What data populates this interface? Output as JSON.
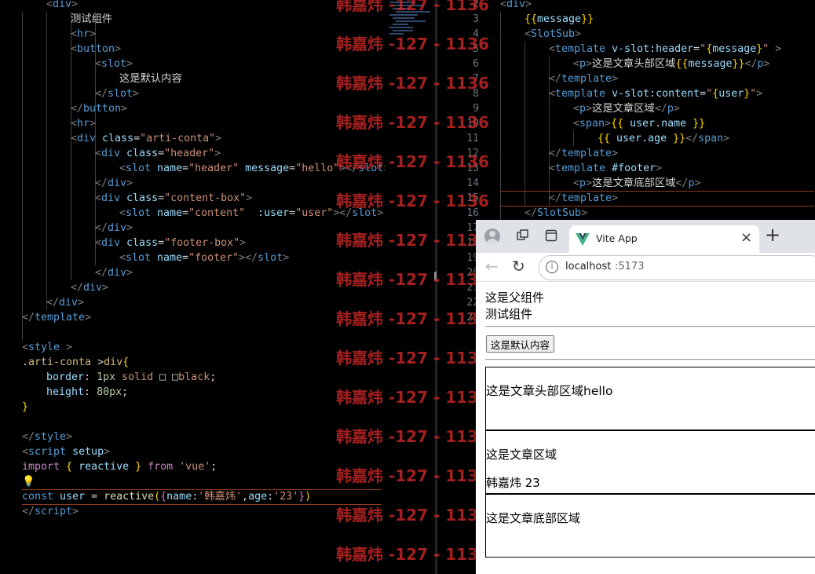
{
  "editor_left": {
    "lines": [
      {
        "indent": 2,
        "parts": [
          [
            "brk",
            "<"
          ],
          [
            "tag",
            "div"
          ],
          [
            "brk",
            ">"
          ]
        ]
      },
      {
        "indent": 3,
        "parts": [
          [
            "txt",
            "测试组件"
          ]
        ]
      },
      {
        "indent": 3,
        "parts": [
          [
            "brk",
            "<"
          ],
          [
            "tag",
            "hr"
          ],
          [
            "brk",
            ">"
          ]
        ]
      },
      {
        "indent": 3,
        "parts": [
          [
            "brk",
            "<"
          ],
          [
            "tag",
            "button"
          ],
          [
            "brk",
            ">"
          ]
        ]
      },
      {
        "indent": 4,
        "parts": [
          [
            "brk",
            "<"
          ],
          [
            "tag",
            "slot"
          ],
          [
            "brk",
            ">"
          ]
        ]
      },
      {
        "indent": 5,
        "parts": [
          [
            "txt",
            "这是默认内容"
          ]
        ]
      },
      {
        "indent": 4,
        "parts": [
          [
            "brk",
            "</"
          ],
          [
            "tag",
            "slot"
          ],
          [
            "brk",
            ">"
          ]
        ]
      },
      {
        "indent": 3,
        "parts": [
          [
            "brk",
            "</"
          ],
          [
            "tag",
            "button"
          ],
          [
            "brk",
            ">"
          ]
        ]
      },
      {
        "indent": 3,
        "parts": [
          [
            "brk",
            "<"
          ],
          [
            "tag",
            "hr"
          ],
          [
            "brk",
            ">"
          ]
        ]
      },
      {
        "indent": 3,
        "parts": [
          [
            "brk",
            "<"
          ],
          [
            "tag",
            "div "
          ],
          [
            "attr",
            "class"
          ],
          [
            "txt",
            "="
          ],
          [
            "str",
            "\"arti-conta\""
          ],
          [
            "brk",
            ">"
          ]
        ]
      },
      {
        "indent": 4,
        "parts": [
          [
            "brk",
            "<"
          ],
          [
            "tag",
            "div "
          ],
          [
            "attr",
            "class"
          ],
          [
            "txt",
            "="
          ],
          [
            "str",
            "\"header\""
          ],
          [
            "brk",
            ">"
          ]
        ]
      },
      {
        "indent": 5,
        "parts": [
          [
            "brk",
            "<"
          ],
          [
            "tag",
            "slot "
          ],
          [
            "attr",
            "name"
          ],
          [
            "txt",
            "="
          ],
          [
            "str",
            "\"header\" "
          ],
          [
            "attr",
            "message"
          ],
          [
            "txt",
            "="
          ],
          [
            "str",
            "\"hello\""
          ],
          [
            "brk",
            "></"
          ],
          [
            "tag",
            "slot"
          ],
          [
            "brk",
            ">"
          ]
        ]
      },
      {
        "indent": 4,
        "parts": [
          [
            "brk",
            "</"
          ],
          [
            "tag",
            "div"
          ],
          [
            "brk",
            ">"
          ]
        ]
      },
      {
        "indent": 4,
        "parts": [
          [
            "brk",
            "<"
          ],
          [
            "tag",
            "div "
          ],
          [
            "attr",
            "class"
          ],
          [
            "txt",
            "="
          ],
          [
            "str",
            "\"content-box\""
          ],
          [
            "brk",
            ">"
          ]
        ]
      },
      {
        "indent": 5,
        "parts": [
          [
            "brk",
            "<"
          ],
          [
            "tag",
            "slot "
          ],
          [
            "attr",
            "name"
          ],
          [
            "txt",
            "="
          ],
          [
            "str",
            "\"content\"  "
          ],
          [
            "attr",
            ":user"
          ],
          [
            "txt",
            "="
          ],
          [
            "str",
            "\"user\""
          ],
          [
            "brk",
            "></"
          ],
          [
            "tag",
            "slot"
          ],
          [
            "brk",
            ">"
          ]
        ]
      },
      {
        "indent": 4,
        "parts": [
          [
            "brk",
            "</"
          ],
          [
            "tag",
            "div"
          ],
          [
            "brk",
            ">"
          ]
        ]
      },
      {
        "indent": 4,
        "parts": [
          [
            "brk",
            "<"
          ],
          [
            "tag",
            "div "
          ],
          [
            "attr",
            "class"
          ],
          [
            "txt",
            "="
          ],
          [
            "str",
            "\"footer-box\""
          ],
          [
            "brk",
            ">"
          ]
        ]
      },
      {
        "indent": 5,
        "parts": [
          [
            "brk",
            "<"
          ],
          [
            "tag",
            "slot "
          ],
          [
            "attr",
            "name"
          ],
          [
            "txt",
            "="
          ],
          [
            "str",
            "\"footer\""
          ],
          [
            "brk",
            "></"
          ],
          [
            "tag",
            "slot"
          ],
          [
            "brk",
            ">"
          ]
        ]
      },
      {
        "indent": 4,
        "parts": [
          [
            "brk",
            "</"
          ],
          [
            "tag",
            "div"
          ],
          [
            "brk",
            ">"
          ]
        ]
      },
      {
        "indent": 3,
        "parts": [
          [
            "brk",
            "</"
          ],
          [
            "tag",
            "div"
          ],
          [
            "brk",
            ">"
          ]
        ]
      },
      {
        "indent": 2,
        "parts": [
          [
            "brk",
            "</"
          ],
          [
            "tag",
            "div"
          ],
          [
            "brk",
            ">"
          ]
        ]
      },
      {
        "indent": 1,
        "parts": [
          [
            "brk",
            "</"
          ],
          [
            "tag",
            "template"
          ],
          [
            "brk",
            ">"
          ]
        ]
      },
      {
        "indent": 1,
        "parts": []
      },
      {
        "indent": 1,
        "parts": [
          [
            "brk",
            "<"
          ],
          [
            "tag",
            "style "
          ],
          [
            "brk",
            ">"
          ]
        ]
      },
      {
        "indent": 1,
        "parts": [
          [
            "sel",
            ".arti-conta "
          ],
          [
            "txt",
            ">"
          ],
          [
            "sel",
            "div"
          ],
          [
            "brace",
            "{"
          ]
        ]
      },
      {
        "indent": 2,
        "parts": [
          [
            "attr",
            "border"
          ],
          [
            "txt",
            ": "
          ],
          [
            "num",
            "1px"
          ],
          [
            "str",
            " solid "
          ],
          [
            "txt",
            "□ □"
          ],
          [
            "str",
            "black"
          ],
          [
            "txt",
            ";"
          ]
        ]
      },
      {
        "indent": 2,
        "parts": [
          [
            "attr",
            "height"
          ],
          [
            "txt",
            ": "
          ],
          [
            "num",
            "80px"
          ],
          [
            "txt",
            ";"
          ]
        ]
      },
      {
        "indent": 1,
        "parts": [
          [
            "brace",
            "}"
          ]
        ]
      },
      {
        "indent": 1,
        "parts": []
      },
      {
        "indent": 1,
        "parts": [
          [
            "brk",
            "</"
          ],
          [
            "tag",
            "style"
          ],
          [
            "brk",
            ">"
          ]
        ]
      },
      {
        "indent": 1,
        "parts": [
          [
            "brk",
            "<"
          ],
          [
            "tag",
            "script "
          ],
          [
            "attr",
            "setup"
          ],
          [
            "brk",
            ">"
          ]
        ]
      },
      {
        "indent": 1,
        "parts": [
          [
            "kw",
            "import "
          ],
          [
            "brace",
            "{ "
          ],
          [
            "attr",
            "reactive "
          ],
          [
            "brace",
            "} "
          ],
          [
            "kw",
            "from "
          ],
          [
            "str",
            "'vue'"
          ],
          [
            "txt",
            ";"
          ]
        ]
      },
      {
        "indent": 1,
        "parts": [
          [
            "fn",
            "💡"
          ]
        ]
      },
      {
        "indent": 1,
        "parts": [
          [
            "tag",
            "const "
          ],
          [
            "attr",
            "user "
          ],
          [
            "txt",
            "= "
          ],
          [
            "fn",
            "reactive"
          ],
          [
            "brace",
            "("
          ],
          [
            "brace2",
            "{"
          ],
          [
            "attr",
            "name"
          ],
          [
            "txt",
            ":"
          ],
          [
            "str",
            "'韩嘉炜'"
          ],
          [
            "txt",
            ","
          ],
          [
            "attr",
            "age"
          ],
          [
            "txt",
            ":"
          ],
          [
            "str",
            "'23'"
          ],
          [
            "brace2",
            "}"
          ],
          [
            "brace",
            ")"
          ]
        ]
      },
      {
        "indent": 1,
        "parts": [
          [
            "brk",
            "</"
          ],
          [
            "tag",
            "script"
          ],
          [
            "brk",
            ">"
          ]
        ]
      }
    ],
    "gutter": [
      "",
      "",
      "",
      "",
      "",
      "",
      "",
      "",
      "",
      "",
      "",
      "",
      "",
      "",
      "",
      "",
      "",
      "",
      "",
      "",
      "",
      "",
      "",
      "",
      "",
      "",
      "",
      "",
      "",
      "",
      "",
      "",
      "",
      "",
      ""
    ]
  },
  "editor_right": {
    "gutter": [
      "2",
      "3",
      "4",
      "5",
      "6",
      "7",
      "8",
      "9",
      "10",
      "11",
      "12",
      "13",
      "14",
      "15",
      "16",
      "17",
      "18",
      "19",
      "20",
      "21",
      "22",
      "23"
    ],
    "lines": [
      {
        "indent": 0,
        "parts": [
          [
            "brk",
            "<"
          ],
          [
            "tag",
            "div"
          ],
          [
            "brk",
            ">"
          ]
        ]
      },
      {
        "indent": 1,
        "parts": [
          [
            "brace",
            "{{"
          ],
          [
            "attr",
            "message"
          ],
          [
            "brace",
            "}}"
          ]
        ]
      },
      {
        "indent": 1,
        "parts": [
          [
            "brk",
            "<"
          ],
          [
            "tag",
            "SlotSub"
          ],
          [
            "brk",
            ">"
          ]
        ]
      },
      {
        "indent": 2,
        "parts": [
          [
            "brk",
            "<"
          ],
          [
            "tag",
            "template "
          ],
          [
            "attr",
            "v-slot:header"
          ],
          [
            "txt",
            "="
          ],
          [
            "str",
            "\""
          ],
          [
            "brace",
            "{"
          ],
          [
            "attr",
            "message"
          ],
          [
            "brace",
            "}"
          ],
          [
            "str",
            "\""
          ],
          [
            "brk",
            " >"
          ]
        ]
      },
      {
        "indent": 3,
        "parts": [
          [
            "brk",
            "<"
          ],
          [
            "tag",
            "p"
          ],
          [
            "brk",
            ">"
          ],
          [
            "txt",
            "这是文章头部区域"
          ],
          [
            "brace",
            "{{"
          ],
          [
            "attr",
            "message"
          ],
          [
            "brace",
            "}}"
          ],
          [
            "brk",
            "</"
          ],
          [
            "tag",
            "p"
          ],
          [
            "brk",
            ">"
          ]
        ]
      },
      {
        "indent": 2,
        "parts": [
          [
            "brk",
            "</"
          ],
          [
            "tag",
            "template"
          ],
          [
            "brk",
            ">"
          ]
        ]
      },
      {
        "indent": 2,
        "parts": [
          [
            "brk",
            "<"
          ],
          [
            "tag",
            "template "
          ],
          [
            "attr",
            "v-slot:content"
          ],
          [
            "txt",
            "="
          ],
          [
            "str",
            "\""
          ],
          [
            "brace",
            "{"
          ],
          [
            "attr",
            "user"
          ],
          [
            "brace",
            "}"
          ],
          [
            "str",
            "\""
          ],
          [
            "brk",
            ">"
          ]
        ]
      },
      {
        "indent": 3,
        "parts": [
          [
            "brk",
            "<"
          ],
          [
            "tag",
            "p"
          ],
          [
            "brk",
            ">"
          ],
          [
            "txt",
            "这是文章区域"
          ],
          [
            "brk",
            "</"
          ],
          [
            "tag",
            "p"
          ],
          [
            "brk",
            ">"
          ]
        ]
      },
      {
        "indent": 3,
        "parts": [
          [
            "brk",
            "<"
          ],
          [
            "tag",
            "span"
          ],
          [
            "brk",
            ">"
          ],
          [
            "brace",
            "{{ "
          ],
          [
            "attr",
            "user"
          ],
          [
            "txt",
            "."
          ],
          [
            "attr",
            "name "
          ],
          [
            "brace",
            "}}"
          ]
        ]
      },
      {
        "indent": 4,
        "parts": [
          [
            "brace",
            "{{ "
          ],
          [
            "attr",
            "user"
          ],
          [
            "txt",
            "."
          ],
          [
            "attr",
            "age "
          ],
          [
            "brace",
            "}}"
          ],
          [
            "brk",
            "</"
          ],
          [
            "tag",
            "span"
          ],
          [
            "brk",
            ">"
          ]
        ]
      },
      {
        "indent": 2,
        "parts": [
          [
            "brk",
            "</"
          ],
          [
            "tag",
            "template"
          ],
          [
            "brk",
            ">"
          ]
        ]
      },
      {
        "indent": 2,
        "parts": [
          [
            "brk",
            "<"
          ],
          [
            "tag",
            "template "
          ],
          [
            "attr",
            "#footer"
          ],
          [
            "brk",
            ">"
          ]
        ]
      },
      {
        "indent": 3,
        "parts": [
          [
            "brk",
            "<"
          ],
          [
            "tag",
            "p"
          ],
          [
            "brk",
            ">"
          ],
          [
            "txt",
            "这是文章底部区域"
          ],
          [
            "brk",
            "</"
          ],
          [
            "tag",
            "p"
          ],
          [
            "brk",
            ">"
          ]
        ]
      },
      {
        "indent": 2,
        "parts": [
          [
            "brk",
            "</"
          ],
          [
            "tag",
            "template"
          ],
          [
            "brk",
            ">"
          ]
        ]
      },
      {
        "indent": 1,
        "parts": [
          [
            "brk",
            "</"
          ],
          [
            "tag",
            "SlotSub"
          ],
          [
            "brk",
            ">"
          ]
        ]
      }
    ]
  },
  "watermark": {
    "text": "韩嘉炜 -127 - 1136",
    "count": 15
  },
  "browser": {
    "tab_title": "Vite App",
    "url_host": "localhost",
    "url_port": ":5173",
    "content": {
      "parent_label": "这是父组件",
      "child_label": "测试组件",
      "button_label": "这是默认内容",
      "header_text": "这是文章头部区域hello",
      "content_text": "这是文章区域",
      "user_line": "韩嘉炜 23",
      "footer_text": "这是文章底部区域"
    }
  },
  "colors": {
    "editor_bg": "#000000",
    "tab_bar": "#dfe3e8",
    "vue_green": "#41b883",
    "watermark": "#d22828"
  }
}
